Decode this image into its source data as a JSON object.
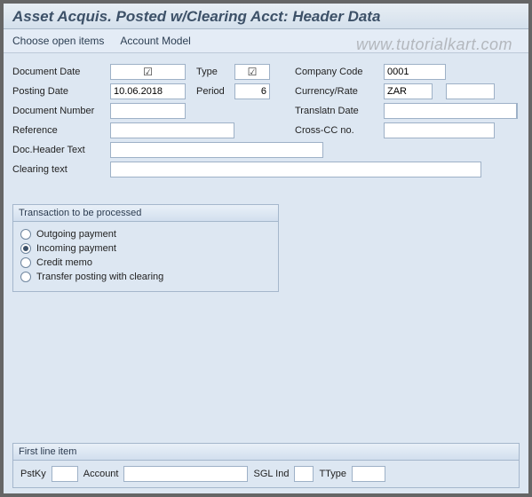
{
  "window": {
    "title": "Asset Acquis. Posted w/Clearing Acct: Header Data"
  },
  "toolbar": {
    "choose_open_items": "Choose open items",
    "account_model": "Account Model"
  },
  "watermark": "www.tutorialkart.com",
  "header": {
    "document_date": {
      "label": "Document Date",
      "value": "",
      "required": true
    },
    "type": {
      "label": "Type",
      "value": "",
      "required": true
    },
    "company_code": {
      "label": "Company Code",
      "value": "0001"
    },
    "posting_date": {
      "label": "Posting Date",
      "value": "10.06.2018"
    },
    "period": {
      "label": "Period",
      "value": "6"
    },
    "currency_rate": {
      "label": "Currency/Rate",
      "value": "ZAR",
      "extra": ""
    },
    "document_number": {
      "label": "Document Number",
      "value": ""
    },
    "translatn_date": {
      "label": "Translatn Date",
      "value": ""
    },
    "reference": {
      "label": "Reference",
      "value": ""
    },
    "cross_cc_no": {
      "label": "Cross-CC no.",
      "value": ""
    },
    "doc_header_text": {
      "label": "Doc.Header Text",
      "value": ""
    },
    "clearing_text": {
      "label": "Clearing text",
      "value": ""
    }
  },
  "transaction_group": {
    "title": "Transaction to be processed",
    "options": [
      {
        "label": "Outgoing payment",
        "selected": false
      },
      {
        "label": "Incoming payment",
        "selected": true
      },
      {
        "label": "Credit memo",
        "selected": false
      },
      {
        "label": "Transfer posting with clearing",
        "selected": false
      }
    ]
  },
  "first_line": {
    "title": "First line item",
    "pstky": {
      "label": "PstKy",
      "value": ""
    },
    "account": {
      "label": "Account",
      "value": ""
    },
    "sgl_ind": {
      "label": "SGL Ind",
      "value": ""
    },
    "ttype": {
      "label": "TType",
      "value": ""
    }
  },
  "icons": {
    "required_check": "☑"
  }
}
